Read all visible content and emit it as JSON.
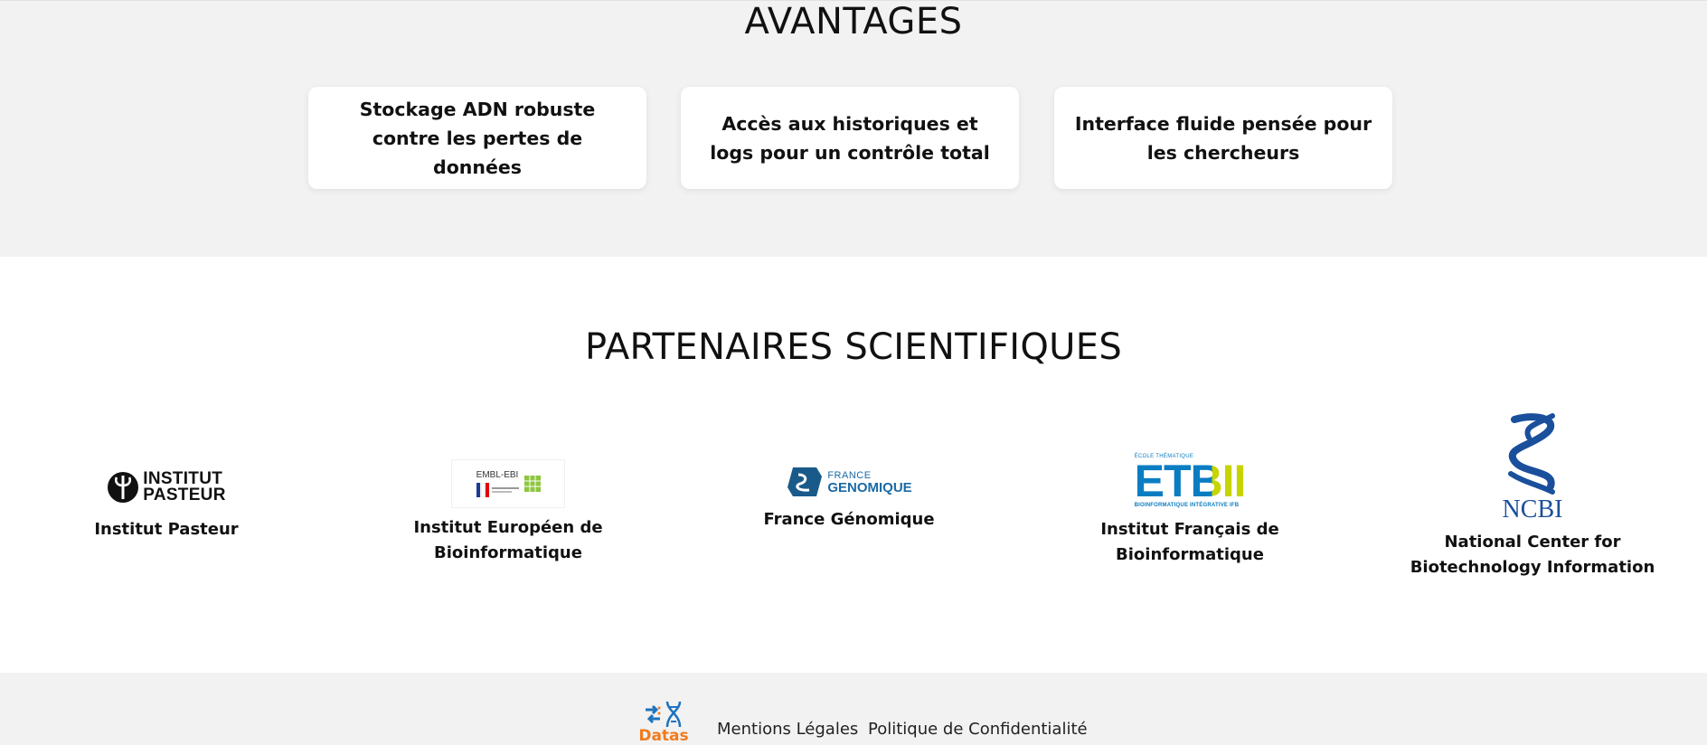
{
  "advantages": {
    "title": "AVANTAGES",
    "cards": [
      {
        "text": "Stockage ADN robuste contre les pertes de données"
      },
      {
        "text": "Accès aux historiques et logs pour un contrôle total"
      },
      {
        "text": "Interface fluide pensée pour les chercheurs"
      }
    ]
  },
  "partners": {
    "title": "PARTENAIRES SCIENTIFIQUES",
    "items": [
      {
        "name": "Institut Pasteur",
        "logo_line1": "INSTITUT",
        "logo_line2": "PASTEUR"
      },
      {
        "name": "Institut Européen de Bioinformatique",
        "logo_text": "EMBL-EBI"
      },
      {
        "name": "France Génomique",
        "logo_line1": "FRANCE",
        "logo_line2": "GENOMIQUE"
      },
      {
        "name": "Institut Français de Bioinformatique",
        "logo_top": "ÉCOLE THÉMATIQUE",
        "logo_main": "ETBII",
        "logo_bottom": "BIOINFORMATIQUE INTÉGRATIVE IFB"
      },
      {
        "name": "National Center for Biotechnology Information",
        "logo_text": "NCBI"
      }
    ]
  },
  "footer": {
    "brand": "Datas",
    "links": [
      "Mentions Légales",
      "Politique de Confidentialité"
    ]
  },
  "colors": {
    "section_bg": "#f2f2f2",
    "brand_orange": "#f07b1d",
    "brand_blue": "#1e73be",
    "etbii_blue": "#0a7dc2",
    "etbii_yellow": "#c8d400",
    "ncbi_blue": "#1a4f9c"
  }
}
